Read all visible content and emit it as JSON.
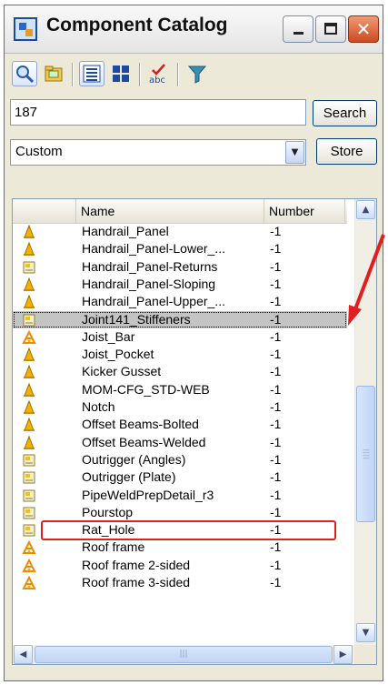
{
  "window": {
    "title": "Component Catalog"
  },
  "search": {
    "value": "187",
    "button_label": "Search"
  },
  "filter": {
    "selected": "Custom",
    "store_label": "Store"
  },
  "list": {
    "columns": {
      "name": "Name",
      "number": "Number"
    },
    "rows": [
      {
        "icon": "cone-icon",
        "name": "Handrail_Panel",
        "number": "-1"
      },
      {
        "icon": "cone-icon",
        "name": "Handrail_Panel-Lower_...",
        "number": "-1"
      },
      {
        "icon": "detail-icon",
        "name": "Handrail_Panel-Returns",
        "number": "-1"
      },
      {
        "icon": "cone-icon",
        "name": "Handrail_Panel-Sloping",
        "number": "-1"
      },
      {
        "icon": "cone-icon",
        "name": "Handrail_Panel-Upper_...",
        "number": "-1"
      },
      {
        "icon": "detail-icon",
        "name": "Joint141_Stiffeners",
        "number": "-1",
        "selected": true
      },
      {
        "icon": "frame-icon",
        "name": "Joist_Bar",
        "number": "-1"
      },
      {
        "icon": "cone-icon",
        "name": "Joist_Pocket",
        "number": "-1"
      },
      {
        "icon": "cone-icon",
        "name": "Kicker Gusset",
        "number": "-1"
      },
      {
        "icon": "cone-icon",
        "name": "MOM-CFG_STD-WEB",
        "number": "-1"
      },
      {
        "icon": "cone-icon",
        "name": "Notch",
        "number": "-1"
      },
      {
        "icon": "cone-icon",
        "name": "Offset Beams-Bolted",
        "number": "-1"
      },
      {
        "icon": "cone-icon",
        "name": "Offset Beams-Welded",
        "number": "-1"
      },
      {
        "icon": "detail-icon",
        "name": "Outrigger (Angles)",
        "number": "-1"
      },
      {
        "icon": "detail-icon",
        "name": "Outrigger (Plate)",
        "number": "-1"
      },
      {
        "icon": "detail-icon",
        "name": "PipeWeldPrepDetail_r3",
        "number": "-1"
      },
      {
        "icon": "detail-icon",
        "name": "Pourstop",
        "number": "-1"
      },
      {
        "icon": "detail-icon",
        "name": "Rat_Hole",
        "number": "-1"
      },
      {
        "icon": "frame-icon",
        "name": "Roof frame",
        "number": "-1"
      },
      {
        "icon": "frame-icon",
        "name": "Roof frame 2-sided",
        "number": "-1"
      },
      {
        "icon": "frame-icon",
        "name": "Roof frame 3-sided",
        "number": "-1"
      }
    ]
  },
  "colors": {
    "highlight": "#e02020",
    "selection": "#c4c4c4",
    "arrow": "#e02020"
  }
}
